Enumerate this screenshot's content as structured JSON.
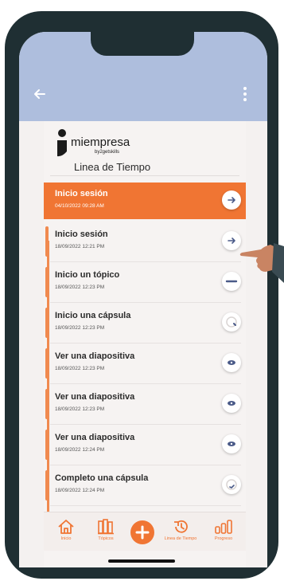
{
  "app": {
    "logo_text": "miempresa",
    "logo_subtext": "by2getskills",
    "page_title": "Linea de Tiempo"
  },
  "header": {
    "back_icon": "arrow-left-icon",
    "menu_icon": "kebab-menu-icon"
  },
  "timeline": {
    "items": [
      {
        "name": "Inicio sesión",
        "time": "04/10/2022 09:28 AM",
        "icon": "login-arrow-icon",
        "active": true
      },
      {
        "name": "Inicio sesión",
        "time": "18/09/2022 12:21 PM",
        "icon": "login-arrow-icon",
        "active": false
      },
      {
        "name": "Inicio un tópico",
        "time": "18/09/2022 12:23 PM",
        "icon": "topic-bar-icon",
        "active": false
      },
      {
        "name": "Inicio una cápsula",
        "time": "18/09/2022 12:23 PM",
        "icon": "capsule-progress-icon",
        "active": false
      },
      {
        "name": "Ver una diapositiva",
        "time": "18/09/2022 12:23 PM",
        "icon": "eye-icon",
        "active": false
      },
      {
        "name": "Ver una diapositiva",
        "time": "18/09/2022 12:23 PM",
        "icon": "eye-icon",
        "active": false
      },
      {
        "name": "Ver una diapositiva",
        "time": "18/09/2022 12:24 PM",
        "icon": "eye-icon",
        "active": false
      },
      {
        "name": "Completo una cápsula",
        "time": "18/09/2022 12:24 PM",
        "icon": "capsule-complete-icon",
        "active": false
      }
    ]
  },
  "tabbar": {
    "tabs": [
      {
        "label": "Inicio",
        "icon": "home-icon"
      },
      {
        "label": "Tópicos",
        "icon": "books-icon"
      },
      {
        "label": "",
        "icon": "plus-icon"
      },
      {
        "label": "Linea de Tiempo",
        "icon": "history-icon"
      },
      {
        "label": "Progreso",
        "icon": "bar-chart-icon"
      }
    ]
  },
  "colors": {
    "accent": "#f07533",
    "appbar": "#aebedd",
    "phone_frame": "#1f2f33",
    "background": "#f6f3f2"
  }
}
